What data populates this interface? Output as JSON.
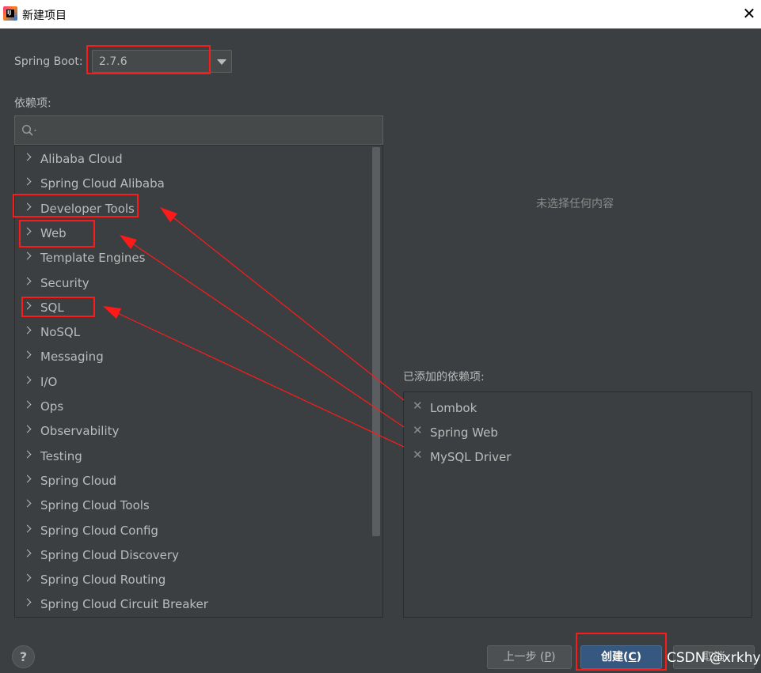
{
  "window": {
    "title": "新建项目",
    "close_glyph": "✕"
  },
  "spring_boot": {
    "label": "Spring Boot:",
    "value": "2.7.6"
  },
  "dependencies": {
    "label": "依赖项:",
    "categories": [
      "Alibaba Cloud",
      "Spring Cloud Alibaba",
      "Developer Tools",
      "Web",
      "Template Engines",
      "Security",
      "SQL",
      "NoSQL",
      "Messaging",
      "I/O",
      "Ops",
      "Observability",
      "Testing",
      "Spring Cloud",
      "Spring Cloud Tools",
      "Spring Cloud Config",
      "Spring Cloud Discovery",
      "Spring Cloud Routing",
      "Spring Cloud Circuit Breaker"
    ]
  },
  "detail": {
    "empty_message": "未选择任何内容"
  },
  "added": {
    "label": "已添加的依赖项:",
    "items": [
      "Lombok",
      "Spring Web",
      "MySQL Driver"
    ],
    "remove_glyph": "✕"
  },
  "footer": {
    "help": "?",
    "prev_text": "上一步 (",
    "prev_key": "P",
    "prev_end": ")",
    "create_text": "创建(",
    "create_key": "C",
    "create_end": ")",
    "cancel": "取消"
  },
  "watermark": "CSDN @xrkhy",
  "colors": {
    "accent": "#365880",
    "annotation": "#ff1a1a",
    "background": "#3c3f41"
  },
  "icons": {
    "search": "search-icon",
    "app": "intellij-idea-icon"
  }
}
